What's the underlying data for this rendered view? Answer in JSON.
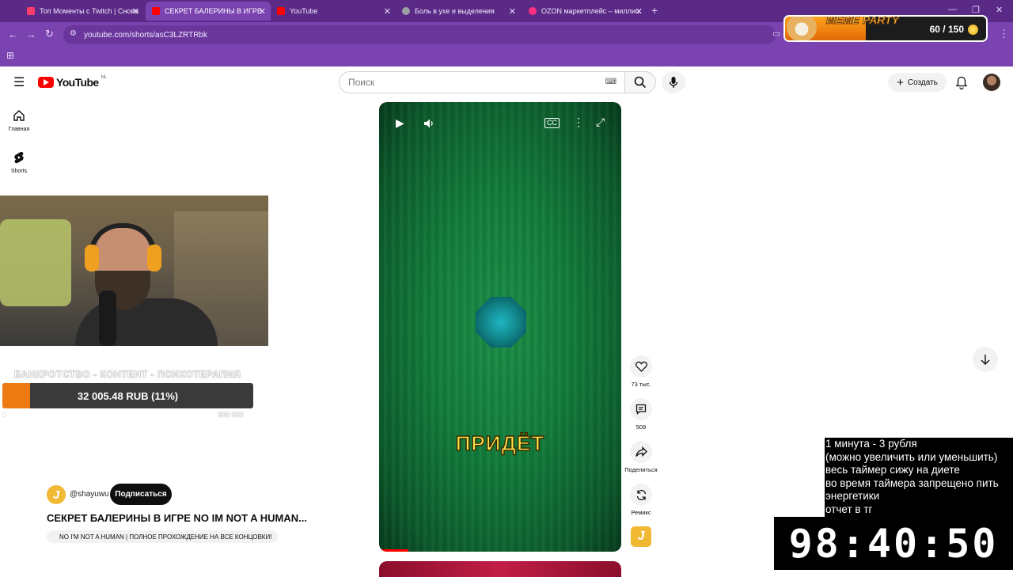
{
  "browser": {
    "tabs": [
      {
        "title": "Топ Моменты с Twitch | Снова",
        "color": "#ff3b6b",
        "active": false
      },
      {
        "title": "СЕКРЕТ БАЛЕРИНЫ В ИГРЕ",
        "color": "#ff0000",
        "active": true
      },
      {
        "title": "YouTube",
        "color": "#ff0000",
        "active": false
      },
      {
        "title": "Боль в ухе и выделения",
        "color": "#9aa0a6",
        "active": false
      },
      {
        "title": "OZON маркетплейс – миллио",
        "color": "#ff2e7e",
        "active": false
      }
    ],
    "url": "youtube.com/shorts/asC3LZRTRbk"
  },
  "youtube": {
    "logo": "YouTube",
    "region": "NL",
    "search_placeholder": "Поиск",
    "create_label": "Создать",
    "nav": [
      {
        "label": "Главная",
        "icon": "home-icon"
      },
      {
        "label": "Shorts",
        "icon": "shorts-icon"
      }
    ],
    "short": {
      "subtitle": "ПРИДЁТ",
      "progress_pct": 12,
      "channel_handle": "@shayuwu",
      "subscribe_label": "Подписаться",
      "title": "СЕКРЕТ БАЛЕРИНЫ В ИГРЕ NO IM NOT A HUMAN...",
      "playlist": "NO I'M NOT A HUMAN | ПОЛНОЕ ПРОХОЖДЕНИЕ НА ВСЕ КОНЦОВКИ!"
    },
    "actions": [
      {
        "label": "73 тыс.",
        "icon": "like-icon"
      },
      {
        "label": "509",
        "icon": "comment-icon"
      },
      {
        "label": "Поделиться",
        "icon": "share-icon"
      },
      {
        "label": "Ремикс",
        "icon": "remix-icon"
      }
    ]
  },
  "stream": {
    "goal_title": "БАНКРОТСТВО - КОНТЕНТ - ПСИХОТЕРАПИЯ",
    "goal_text": "32 005.48 RUB (11%)",
    "goal_fraction": 0.11,
    "goal_min": "0",
    "goal_max": "300 000",
    "meme_title": "MEME PARTY",
    "meme_count": "60 / 150",
    "meme_fraction": 0.4,
    "info_lines": [
      "1 минута - 3 рубля",
      "(можно увеличить или уменьшить)",
      "весь таймер сижу на диете",
      "во время таймера запрещено пить",
      "энергетики",
      "отчет в тг"
    ],
    "timer": "98:40:50"
  }
}
